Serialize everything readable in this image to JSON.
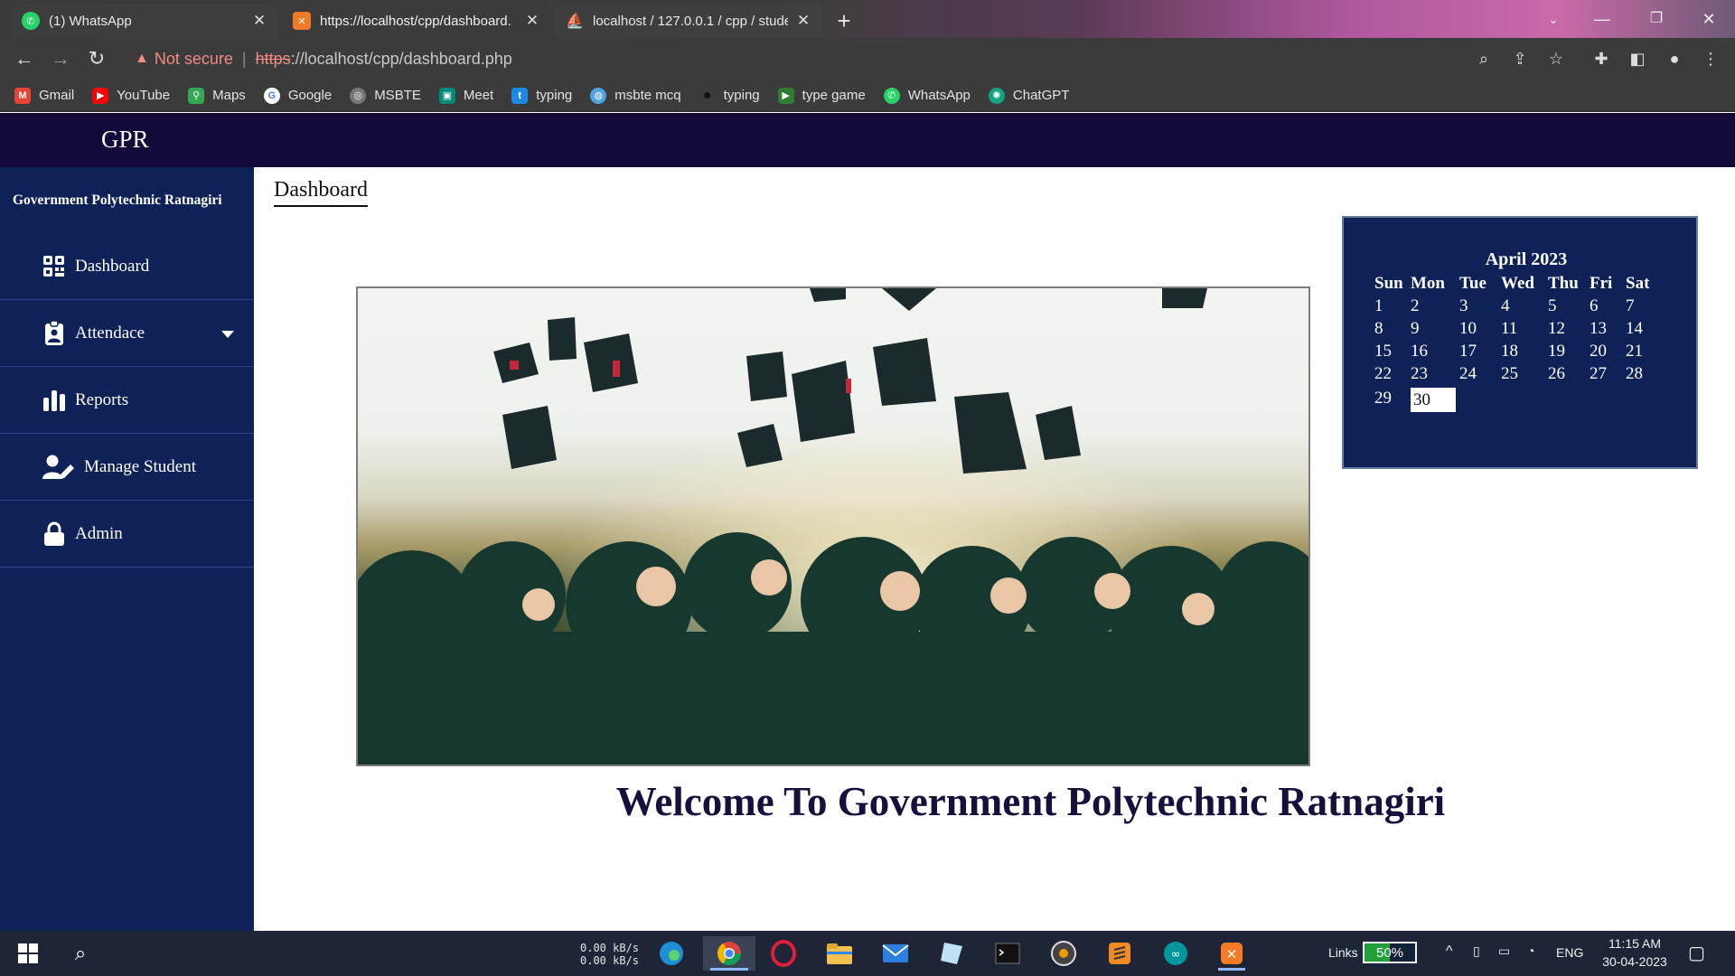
{
  "browser": {
    "tabs": [
      {
        "title": "(1) WhatsApp",
        "favicon": "whatsapp-icon",
        "active": false
      },
      {
        "title": "https://localhost/cpp/dashboard.",
        "favicon": "xampp-icon",
        "active": true
      },
      {
        "title": "localhost / 127.0.0.1 / cpp / stude",
        "favicon": "phpmyadmin-icon",
        "active": false
      }
    ],
    "address": {
      "warning": "Not secure",
      "scheme": "https",
      "rest": "://localhost/cpp/dashboard.php"
    },
    "bookmarks": [
      {
        "label": "Gmail",
        "icon": "gmail-icon",
        "color": "#ea4335"
      },
      {
        "label": "YouTube",
        "icon": "youtube-icon",
        "color": "#ff0000"
      },
      {
        "label": "Maps",
        "icon": "maps-icon",
        "color": "#34a853"
      },
      {
        "label": "Google",
        "icon": "google-icon",
        "color": "#4285f4"
      },
      {
        "label": "MSBTE",
        "icon": "msbte-icon",
        "color": "#777777"
      },
      {
        "label": "Meet",
        "icon": "meet-icon",
        "color": "#00897b"
      },
      {
        "label": "typing",
        "icon": "typing-icon",
        "color": "#1e88e5"
      },
      {
        "label": "msbte mcq",
        "icon": "mcq-icon",
        "color": "#4fa3e0"
      },
      {
        "label": "typing",
        "icon": "paw-icon",
        "color": "#222222"
      },
      {
        "label": "type game",
        "icon": "play-icon",
        "color": "#2e7d32"
      },
      {
        "label": "WhatsApp",
        "icon": "whatsapp-icon",
        "color": "#25d366"
      },
      {
        "label": "ChatGPT",
        "icon": "chatgpt-icon",
        "color": "#10a37f"
      }
    ]
  },
  "page": {
    "brand": "GPR",
    "sidebar_title": "Government Polytechnic Ratnagiri",
    "menu": [
      {
        "label": "Dashboard",
        "icon": "dashboard-grid-icon"
      },
      {
        "label": "Attendace",
        "icon": "clipboard-user-icon",
        "has_dropdown": true
      },
      {
        "label": "Reports",
        "icon": "bar-chart-icon"
      },
      {
        "label": "Manage Student",
        "icon": "user-edit-icon"
      },
      {
        "label": "Admin",
        "icon": "lock-icon"
      }
    ],
    "heading": "Dashboard",
    "hero_image": "graduation-caps-photo",
    "welcome": "Welcome To Government Polytechnic Ratnagiri",
    "calendar": {
      "title": "April 2023",
      "days": [
        "Sun",
        "Mon",
        "Tue",
        "Wed",
        "Thu",
        "Fri",
        "Sat"
      ],
      "weeks": [
        [
          "1",
          "2",
          "3",
          "4",
          "5",
          "6",
          "7"
        ],
        [
          "8",
          "9",
          "10",
          "11",
          "12",
          "13",
          "14"
        ],
        [
          "15",
          "16",
          "17",
          "18",
          "19",
          "20",
          "21"
        ],
        [
          "22",
          "23",
          "24",
          "25",
          "26",
          "27",
          "28"
        ],
        [
          "29",
          "30",
          "",
          "",
          "",
          "",
          ""
        ]
      ],
      "today": "30"
    }
  },
  "taskbar": {
    "net_up": "0.00 kB/s",
    "net_down": "0.00 kB/s",
    "links_label": "Links",
    "battery": "50%",
    "battery_level": 0.5,
    "language": "ENG",
    "time": "11:15 AM",
    "date": "30-04-2023"
  },
  "colors": {
    "topbar": "#15093a",
    "sidebar": "#0e2257",
    "welcome_text": "#16103d"
  }
}
